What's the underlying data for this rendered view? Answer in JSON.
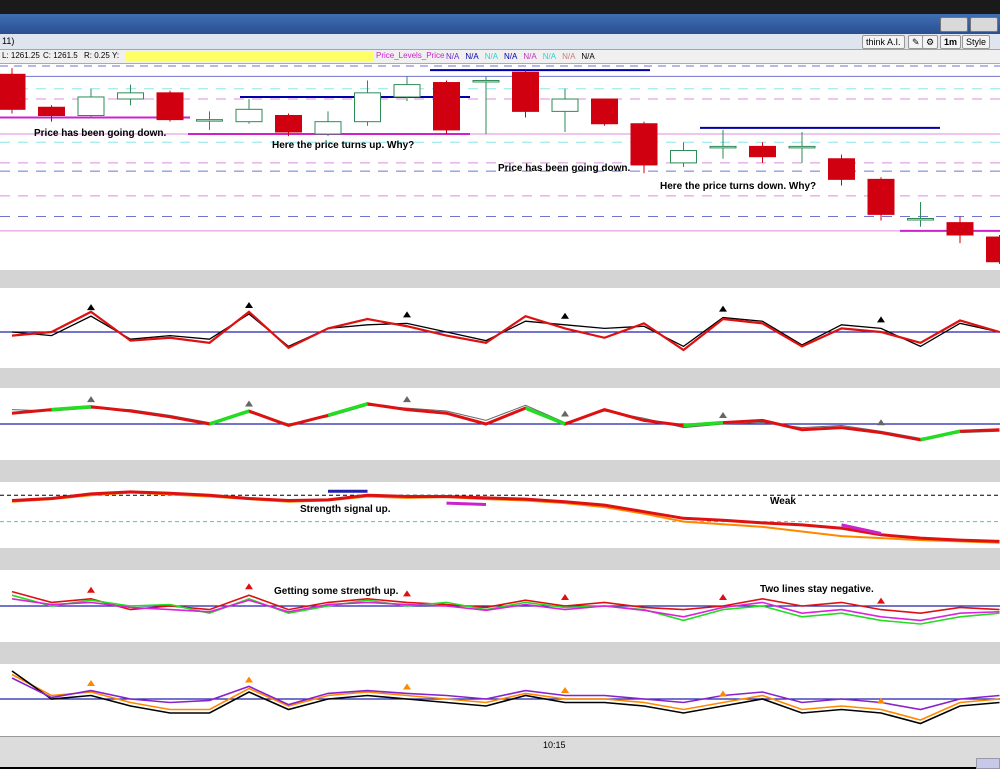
{
  "window": {
    "title_fragment": "11)"
  },
  "toolbar": {
    "think_ai_label": "think A.I.",
    "timeframe_label": "1m",
    "style_label": "Style"
  },
  "infobar": {
    "low": "L: 1261.25",
    "close": "C: 1261.5",
    "range": "R: 0.25",
    "y_label": "Y:",
    "study_name": "Price_Levels_Price",
    "na_values": [
      "N/A",
      "N/A",
      "N/A",
      "N/A",
      "N/A",
      "N/A",
      "N/A",
      "N/A"
    ],
    "na_colors": [
      "#6a2ad0",
      "#0000aa",
      "#30d0d0",
      "#0000aa",
      "#c030c0",
      "#30d0d0",
      "#c08080",
      "#000000"
    ]
  },
  "annotations": {
    "a1": "Price has been going down.",
    "a2": "Here the price turns up.  Why?",
    "a3": "Price has been going down.",
    "a4": "Here the price turns down. Why?",
    "a5": "Strength signal up.",
    "a6": "Weak",
    "a7": "Getting some strength up.",
    "a8": "Two lines stay negative."
  },
  "colors": {
    "bear": "#d00010",
    "bull": "#2e8b57",
    "red_line": "#dd1111",
    "green_line": "#22dd22",
    "black_line": "#000000",
    "blue_line": "#2222aa",
    "orange_line": "#ff8800",
    "magenta_line": "#dd22dd"
  },
  "chart_data": [
    {
      "type": "candlestick",
      "panel": "price",
      "candles": [
        {
          "o": 0.95,
          "c": 0.78,
          "h": 0.98,
          "l": 0.76
        },
        {
          "o": 0.79,
          "c": 0.75,
          "h": 0.8,
          "l": 0.72
        },
        {
          "o": 0.75,
          "c": 0.84,
          "h": 0.88,
          "l": 0.74
        },
        {
          "o": 0.83,
          "c": 0.86,
          "h": 0.9,
          "l": 0.8
        },
        {
          "o": 0.86,
          "c": 0.73,
          "h": 0.87,
          "l": 0.72
        },
        {
          "o": 0.73,
          "c": 0.73,
          "h": 0.77,
          "l": 0.68
        },
        {
          "o": 0.72,
          "c": 0.78,
          "h": 0.83,
          "l": 0.71
        },
        {
          "o": 0.75,
          "c": 0.67,
          "h": 0.76,
          "l": 0.65
        },
        {
          "o": 0.66,
          "c": 0.72,
          "h": 0.77,
          "l": 0.65
        },
        {
          "o": 0.72,
          "c": 0.86,
          "h": 0.92,
          "l": 0.7
        },
        {
          "o": 0.84,
          "c": 0.9,
          "h": 0.94,
          "l": 0.82
        },
        {
          "o": 0.91,
          "c": 0.68,
          "h": 0.92,
          "l": 0.66
        },
        {
          "o": 0.92,
          "c": 0.92,
          "h": 0.94,
          "l": 0.66
        },
        {
          "o": 0.96,
          "c": 0.77,
          "h": 0.97,
          "l": 0.74
        },
        {
          "o": 0.77,
          "c": 0.83,
          "h": 0.88,
          "l": 0.67
        },
        {
          "o": 0.83,
          "c": 0.71,
          "h": 0.83,
          "l": 0.7
        },
        {
          "o": 0.71,
          "c": 0.51,
          "h": 0.72,
          "l": 0.47
        },
        {
          "o": 0.52,
          "c": 0.58,
          "h": 0.62,
          "l": 0.5
        },
        {
          "o": 0.6,
          "c": 0.6,
          "h": 0.68,
          "l": 0.54
        },
        {
          "o": 0.6,
          "c": 0.55,
          "h": 0.62,
          "l": 0.52
        },
        {
          "o": 0.6,
          "c": 0.6,
          "h": 0.67,
          "l": 0.52
        },
        {
          "o": 0.54,
          "c": 0.44,
          "h": 0.56,
          "l": 0.41
        },
        {
          "o": 0.44,
          "c": 0.27,
          "h": 0.45,
          "l": 0.24
        },
        {
          "o": 0.25,
          "c": 0.25,
          "h": 0.33,
          "l": 0.21
        },
        {
          "o": 0.23,
          "c": 0.17,
          "h": 0.26,
          "l": 0.13
        },
        {
          "o": 0.16,
          "c": 0.04,
          "h": 0.17,
          "l": 0.03
        }
      ]
    },
    {
      "type": "line",
      "panel": "oscillator-1",
      "series": [
        {
          "values": [
            0.5,
            0.45,
            0.72,
            0.4,
            0.45,
            0.4,
            0.75,
            0.3,
            0.55,
            0.6,
            0.62,
            0.5,
            0.38,
            0.65,
            0.6,
            0.55,
            0.58,
            0.3,
            0.7,
            0.65,
            0.32,
            0.6,
            0.55,
            0.3,
            0.62,
            0.5
          ]
        },
        {
          "values": [
            0.45,
            0.5,
            0.78,
            0.38,
            0.42,
            0.35,
            0.78,
            0.28,
            0.55,
            0.68,
            0.58,
            0.45,
            0.35,
            0.72,
            0.55,
            0.42,
            0.62,
            0.25,
            0.68,
            0.62,
            0.3,
            0.55,
            0.5,
            0.35,
            0.66,
            0.5
          ]
        }
      ]
    },
    {
      "type": "line",
      "panel": "oscillator-2",
      "series": [
        {
          "values": [
            0.7,
            0.68,
            0.72,
            0.7,
            0.62,
            0.52,
            0.66,
            0.5,
            0.6,
            0.76,
            0.72,
            0.68,
            0.55,
            0.76,
            0.52,
            0.68,
            0.58,
            0.45,
            0.5,
            0.52,
            0.45,
            0.48,
            0.4,
            0.3,
            0.38,
            0.4
          ]
        },
        {
          "values": [
            0.65,
            0.7,
            0.74,
            0.68,
            0.6,
            0.5,
            0.68,
            0.48,
            0.62,
            0.78,
            0.7,
            0.65,
            0.5,
            0.72,
            0.5,
            0.7,
            0.55,
            0.48,
            0.52,
            0.55,
            0.42,
            0.45,
            0.38,
            0.28,
            0.4,
            0.42
          ]
        }
      ]
    },
    {
      "type": "line",
      "panel": "strength",
      "series": [
        {
          "values": [
            0.72,
            0.75,
            0.82,
            0.85,
            0.83,
            0.8,
            0.75,
            0.72,
            0.73,
            0.8,
            0.78,
            0.78,
            0.76,
            0.74,
            0.7,
            0.65,
            0.55,
            0.45,
            0.42,
            0.38,
            0.35,
            0.3,
            0.2,
            0.15,
            0.12,
            0.1
          ]
        },
        {
          "values": [
            0.7,
            0.74,
            0.8,
            0.84,
            0.81,
            0.78,
            0.74,
            0.7,
            0.72,
            0.78,
            0.76,
            0.77,
            0.74,
            0.72,
            0.68,
            0.62,
            0.52,
            0.4,
            0.36,
            0.32,
            0.25,
            0.18,
            0.15,
            0.12,
            0.1,
            0.08
          ]
        }
      ]
    },
    {
      "type": "line",
      "panel": "oscillator-3",
      "series": [
        {
          "values": [
            0.7,
            0.55,
            0.6,
            0.45,
            0.5,
            0.45,
            0.65,
            0.45,
            0.55,
            0.6,
            0.55,
            0.52,
            0.48,
            0.58,
            0.5,
            0.55,
            0.48,
            0.45,
            0.5,
            0.6,
            0.5,
            0.55,
            0.45,
            0.4,
            0.48,
            0.45
          ]
        },
        {
          "values": [
            0.65,
            0.5,
            0.58,
            0.5,
            0.52,
            0.4,
            0.6,
            0.4,
            0.5,
            0.58,
            0.5,
            0.55,
            0.45,
            0.55,
            0.48,
            0.5,
            0.45,
            0.3,
            0.45,
            0.5,
            0.35,
            0.4,
            0.3,
            0.25,
            0.35,
            0.4
          ]
        },
        {
          "values": [
            0.6,
            0.52,
            0.55,
            0.48,
            0.45,
            0.42,
            0.58,
            0.42,
            0.52,
            0.55,
            0.52,
            0.5,
            0.44,
            0.52,
            0.45,
            0.5,
            0.44,
            0.35,
            0.48,
            0.55,
            0.4,
            0.45,
            0.35,
            0.3,
            0.4,
            0.42
          ]
        }
      ]
    },
    {
      "type": "line",
      "panel": "oscillator-4",
      "series": [
        {
          "values": [
            0.85,
            0.55,
            0.6,
            0.45,
            0.35,
            0.35,
            0.65,
            0.4,
            0.55,
            0.6,
            0.55,
            0.5,
            0.45,
            0.58,
            0.5,
            0.5,
            0.45,
            0.35,
            0.45,
            0.55,
            0.35,
            0.4,
            0.35,
            0.2,
            0.45,
            0.5
          ]
        },
        {
          "values": [
            0.9,
            0.5,
            0.55,
            0.4,
            0.3,
            0.3,
            0.6,
            0.35,
            0.5,
            0.55,
            0.5,
            0.45,
            0.4,
            0.55,
            0.45,
            0.45,
            0.4,
            0.3,
            0.4,
            0.5,
            0.3,
            0.35,
            0.3,
            0.15,
            0.4,
            0.45
          ]
        },
        {
          "values": [
            0.8,
            0.52,
            0.62,
            0.5,
            0.45,
            0.48,
            0.68,
            0.42,
            0.58,
            0.62,
            0.58,
            0.55,
            0.5,
            0.62,
            0.55,
            0.55,
            0.5,
            0.45,
            0.55,
            0.6,
            0.45,
            0.5,
            0.45,
            0.35,
            0.5,
            0.55
          ]
        }
      ]
    }
  ],
  "x_axis": {
    "tick_label": "10:15"
  }
}
